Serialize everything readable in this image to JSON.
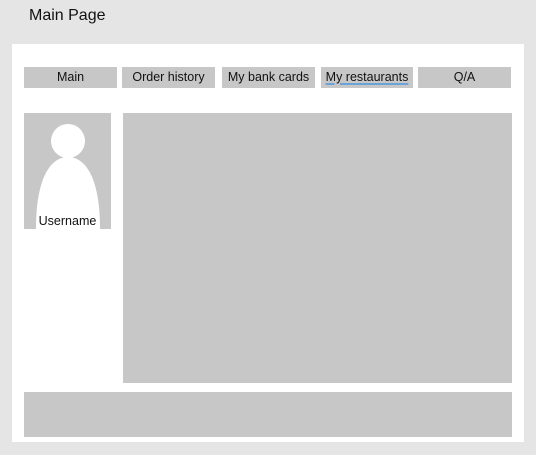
{
  "page": {
    "title": "Main Page"
  },
  "nav": {
    "tabs": [
      {
        "label": "Main"
      },
      {
        "label": "Order history"
      },
      {
        "label": "My bank cards"
      },
      {
        "label": "My restaurants"
      },
      {
        "label": "Q/A"
      }
    ]
  },
  "profile": {
    "username": "Username",
    "avatar_icon": "user-silhouette-icon"
  },
  "colors": {
    "background": "#e5e5e5",
    "canvas": "#ffffff",
    "block": "#c7c7c7",
    "underline": "#6aa3d8"
  }
}
